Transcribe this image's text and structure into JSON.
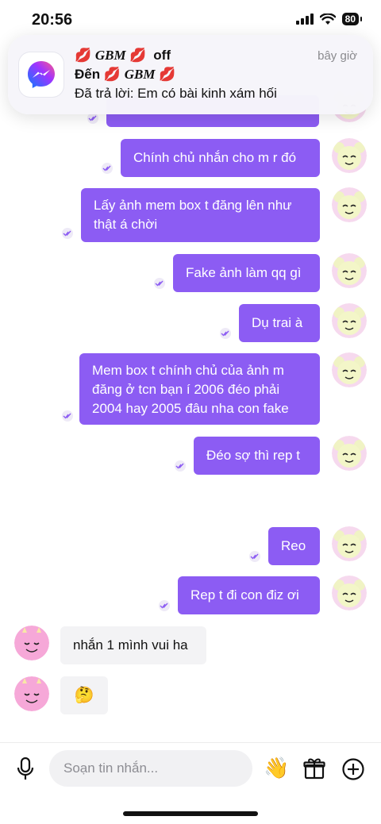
{
  "status": {
    "time": "20:56",
    "battery": "80"
  },
  "notification": {
    "title_name": "GBM",
    "title_suffix": "off",
    "to_prefix": "Đến",
    "to_name": "GBM",
    "body": "Đã trả lời: Em có bài kinh xám hối",
    "time": "bây giờ"
  },
  "messages": [
    {
      "text": "Chính chủ nhắn cho m r đó"
    },
    {
      "text": "Lấy ảnh mem box t đăng lên như thật á chời"
    },
    {
      "text": "Fake ảnh làm qq gì"
    },
    {
      "text": "Dụ trai à"
    },
    {
      "text": "Mem box t chính chủ của ảnh m đăng ở tcn bạn í 2006 đéo phải 2004 hay 2005 đâu nha con fake"
    },
    {
      "text": "Đéo sợ thì rep t"
    },
    {
      "text": "Reo"
    },
    {
      "text": "Rep t đi con điz ơi"
    },
    {
      "text": "nhắn 1 mình vui ha"
    },
    {
      "text": "🤔"
    }
  ],
  "composer": {
    "placeholder": "Soạn tin nhắn...",
    "wave_emoji": "👋"
  },
  "colors": {
    "accent": "#8c5cf3",
    "incoming": "#f3f3f5"
  }
}
